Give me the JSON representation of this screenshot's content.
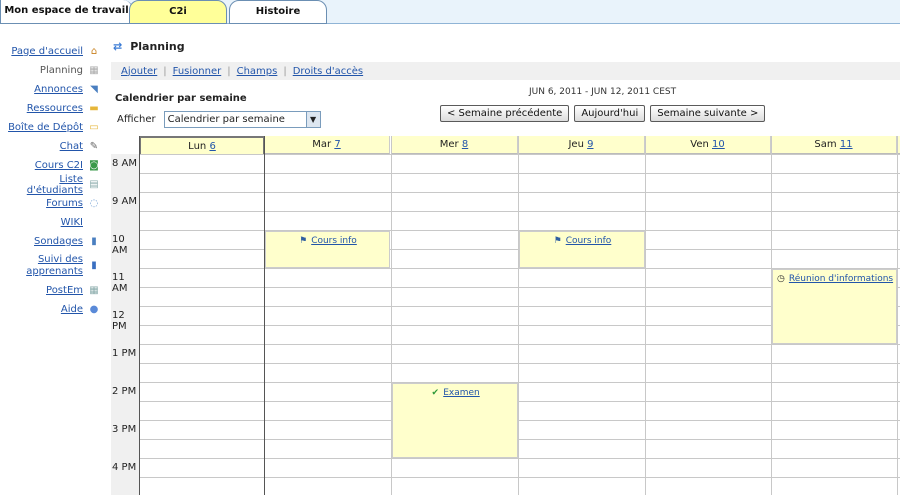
{
  "tabs": [
    {
      "label": "Mon espace de travail"
    },
    {
      "label": "C2i"
    },
    {
      "label": "Histoire"
    }
  ],
  "sidebar": {
    "items": [
      {
        "label": "Page d'accueil",
        "icon": "home-icon",
        "current": false
      },
      {
        "label": "Planning",
        "icon": "calendar-icon",
        "current": true
      },
      {
        "label": "Annonces",
        "icon": "megaphone-icon",
        "current": false
      },
      {
        "label": "Ressources",
        "icon": "folder-icon",
        "current": false
      },
      {
        "label": "Boîte de Dépôt",
        "icon": "dropbox-icon",
        "current": false
      },
      {
        "label": "Chat",
        "icon": "chat-icon",
        "current": false
      },
      {
        "label": "Cours C2I",
        "icon": "course-icon",
        "current": false
      },
      {
        "label": "Liste d'étudiants",
        "icon": "roster-icon",
        "current": false
      },
      {
        "label": "Forums",
        "icon": "forum-icon",
        "current": false
      },
      {
        "label": "WIKI",
        "icon": "",
        "current": false
      },
      {
        "label": "Sondages",
        "icon": "poll-icon",
        "current": false
      },
      {
        "label": "Suivi des apprenants",
        "icon": "chart-icon",
        "current": false
      },
      {
        "label": "PostEm",
        "icon": "postem-icon",
        "current": false
      },
      {
        "label": "Aide",
        "icon": "help-icon",
        "current": false
      }
    ]
  },
  "page": {
    "title": "Planning"
  },
  "actions": [
    {
      "label": "Ajouter"
    },
    {
      "label": "Fusionner"
    },
    {
      "label": "Champs"
    },
    {
      "label": "Droits d'accès"
    }
  ],
  "calendar": {
    "heading": "Calendrier par semaine",
    "show_label": "Afficher",
    "view_select": "Calendrier par semaine",
    "date_range": "JUN 6, 2011 - JUN 12, 2011 CEST",
    "prev_btn": "< Semaine précédente",
    "today_btn": "Aujourd'hui",
    "next_btn": "Semaine suivante >",
    "days": [
      {
        "name": "Lun",
        "num": "6"
      },
      {
        "name": "Mar",
        "num": "7"
      },
      {
        "name": "Mer",
        "num": "8"
      },
      {
        "name": "Jeu",
        "num": "9"
      },
      {
        "name": "Ven",
        "num": "10"
      },
      {
        "name": "Sam",
        "num": "11"
      }
    ],
    "hours": [
      "8 AM",
      "9 AM",
      "10 AM",
      "11 AM",
      "12 PM",
      "1 PM",
      "2 PM",
      "3 PM",
      "4 PM"
    ],
    "events": [
      {
        "title": "Cours info",
        "day": 1,
        "start": 10,
        "end": 11,
        "icon": "flag-icon"
      },
      {
        "title": "Cours info",
        "day": 3,
        "start": 10,
        "end": 11,
        "icon": "flag-icon"
      },
      {
        "title": "Réunion d'informations",
        "day": 5,
        "start": 11,
        "end": 13,
        "icon": "clock-icon"
      },
      {
        "title": "Examen",
        "day": 2,
        "start": 14,
        "end": 16,
        "icon": "check-icon"
      }
    ]
  },
  "colors": {
    "header_bg": "#ffffcc",
    "event_bg": "#ffffcc",
    "link": "#2255aa",
    "active_tab": "#ffff99"
  }
}
